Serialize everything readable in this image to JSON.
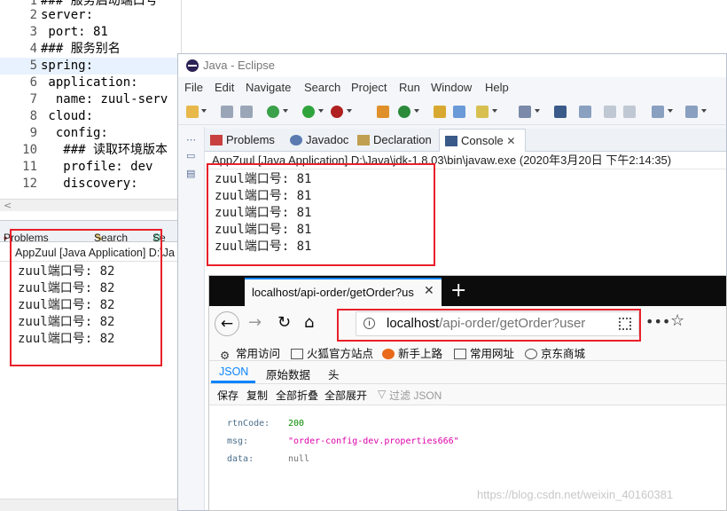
{
  "editor": {
    "lines": [
      {
        "num": "1",
        "text": "### 服务启动端口号"
      },
      {
        "num": "2",
        "text": "server:"
      },
      {
        "num": "3",
        "text": " port: 81"
      },
      {
        "num": "4",
        "text": "### 服务别名"
      },
      {
        "num": "5",
        "text": "spring:"
      },
      {
        "num": "6",
        "text": " application:"
      },
      {
        "num": "7",
        "text": "  name: zuul-serv"
      },
      {
        "num": "8",
        "text": " cloud:"
      },
      {
        "num": "9",
        "text": "  config:"
      },
      {
        "num": "10",
        "text": "   ### 读取环境版本"
      },
      {
        "num": "11",
        "text": "   profile: dev"
      },
      {
        "num": "12",
        "text": "   discovery:"
      }
    ]
  },
  "back_console": {
    "tabs": [
      "Problems",
      "Search",
      "Se"
    ],
    "header": "AppZuul [Java Application] D:\\Ja",
    "lines": [
      "zuul端口号: 82",
      "zuul端口号: 82",
      "zuul端口号: 82",
      "zuul端口号: 82",
      "zuul端口号: 82"
    ]
  },
  "eclipse": {
    "title": "Java - Eclipse",
    "menu": [
      "File",
      "Edit",
      "Navigate",
      "Search",
      "Project",
      "Run",
      "Window",
      "Help"
    ],
    "tabs": [
      "Problems",
      "Javadoc",
      "Declaration",
      "Console"
    ],
    "console_header": "AppZuul [Java Application] D:\\Java\\jdk-1.8.03\\bin\\javaw.exe (2020年3月20日 下午2:14:35)",
    "console_lines": [
      "zuul端口号: 81",
      "zuul端口号: 81",
      "zuul端口号: 81",
      "zuul端口号: 81",
      "zuul端口号: 81"
    ]
  },
  "firefox": {
    "tab_title": "localhost/api-order/getOrder?us",
    "url_host": "localhost",
    "url_path": "/api-order/getOrder?user",
    "bookmarks": [
      "常用访问",
      "火狐官方站点",
      "新手上路",
      "常用网址",
      "京东商城"
    ],
    "json_tabs": [
      "JSON",
      "原始数据",
      "头"
    ],
    "json_tools": [
      "保存",
      "复制",
      "全部折叠",
      "全部展开"
    ],
    "filter_placeholder": "过滤 JSON",
    "json": [
      {
        "key": "rtnCode:",
        "value": "200",
        "type": "num"
      },
      {
        "key": "msg:",
        "value": "\"order-config-dev.properties666\"",
        "type": "str"
      },
      {
        "key": "data:",
        "value": "null",
        "type": "nul"
      }
    ]
  },
  "watermark": "https://blog.csdn.net/weixin_40160381",
  "colors": {
    "highlight_box": "#e8202a",
    "firefox_accent": "#0a84ff"
  }
}
